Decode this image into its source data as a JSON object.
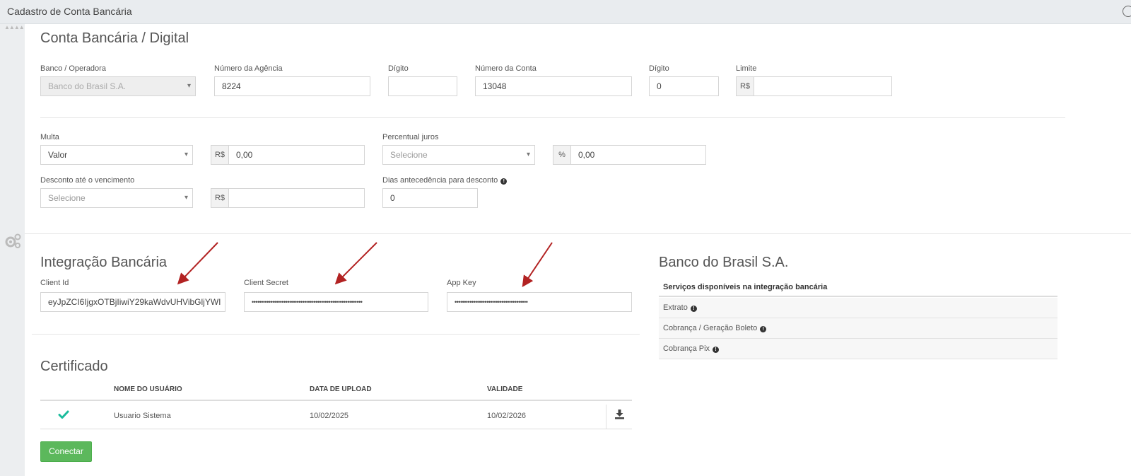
{
  "window": {
    "title": "Cadastro de Conta Bancária"
  },
  "conta": {
    "heading": "Conta Bancária / Digital",
    "banco": {
      "label": "Banco / Operadora",
      "value": "Banco do Brasil S.A."
    },
    "agencia": {
      "label": "Número da Agência",
      "value": "8224"
    },
    "digito_agencia": {
      "label": "Dígito",
      "value": ""
    },
    "conta": {
      "label": "Número da Conta",
      "value": "13048"
    },
    "digito_conta": {
      "label": "Dígito",
      "value": "0"
    },
    "limite": {
      "label": "Limite",
      "prefix": "R$",
      "value": ""
    }
  },
  "cobranca": {
    "multa": {
      "label": "Multa",
      "type": "Valor",
      "prefix": "R$",
      "value": "0,00"
    },
    "juros": {
      "label": "Percentual juros",
      "type": "Selecione",
      "prefix": "%",
      "value": "0,00"
    },
    "desconto": {
      "label": "Desconto até o vencimento",
      "type": "Selecione",
      "prefix": "R$",
      "value": ""
    },
    "dias": {
      "label": "Dias antecedência para desconto",
      "value": "0"
    }
  },
  "integracao": {
    "heading": "Integração Bancária",
    "client_id": {
      "label": "Client Id",
      "value": "eyJpZCI6IjgxOTBjIiwiY29kaWdvUHVibGljYWI"
    },
    "client_secret": {
      "label": "Client Secret",
      "value": "•••••••••••••••••••••••••••••••••••••••••••••••••••••••••••"
    },
    "app_key": {
      "label": "App Key",
      "value": "•••••••••••••••••••••••••••••••••••••••"
    }
  },
  "banco_info": {
    "heading": "Banco do Brasil S.A.",
    "services_header": "Serviços disponíveis na integração bancária",
    "services": [
      "Extrato",
      "Cobrança / Geração Boleto",
      "Cobrança Pix"
    ]
  },
  "certificado": {
    "heading": "Certificado",
    "columns": [
      "NOME DO USUÁRIO",
      "DATA DE UPLOAD",
      "VALIDADE"
    ],
    "rows": [
      {
        "nome": "Usuario Sistema",
        "upload": "10/02/2025",
        "validade": "10/02/2026"
      }
    ],
    "connect_label": "Conectar"
  },
  "colors": {
    "accent_green": "#5cb85c",
    "check_teal": "#1abc9c",
    "arrow_red": "#b22222"
  },
  "icons": [
    "window-control-icon",
    "collapse-handle-icon",
    "gears-icon",
    "info-icon",
    "checkmark-icon",
    "download-icon"
  ]
}
